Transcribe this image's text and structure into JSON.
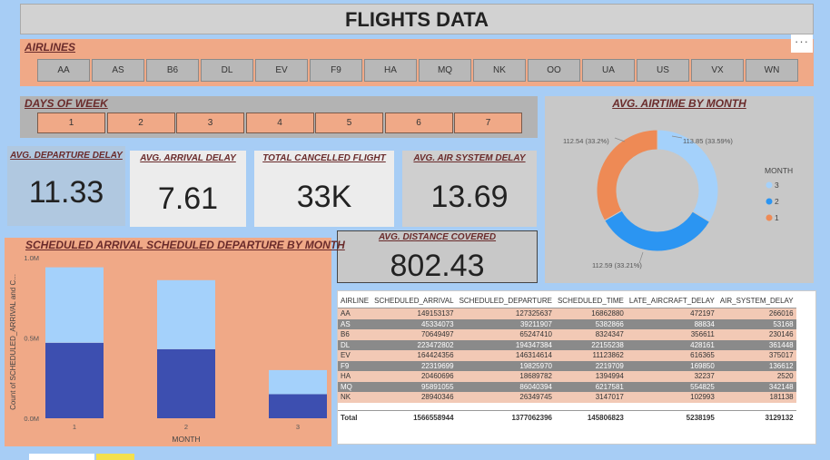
{
  "title": "FLIGHTS DATA",
  "more_options": "···",
  "airlines": {
    "title": "AIRLINES",
    "items": [
      "AA",
      "AS",
      "B6",
      "DL",
      "EV",
      "F9",
      "HA",
      "MQ",
      "NK",
      "OO",
      "UA",
      "US",
      "VX",
      "WN"
    ]
  },
  "days_of_week": {
    "title": "DAYS OF WEEK",
    "items": [
      "1",
      "2",
      "3",
      "4",
      "5",
      "6",
      "7"
    ]
  },
  "kpis": {
    "departure": {
      "title": "AVG. DEPARTURE DELAY",
      "value": "11.33"
    },
    "arrival": {
      "title": "AVG. ARRIVAL DELAY",
      "value": "7.61"
    },
    "cancelled": {
      "title": "TOTAL CANCELLED FLIGHT",
      "value": "33K"
    },
    "air_system": {
      "title": "AVG. AIR SYSTEM DELAY",
      "value": "13.69"
    },
    "distance": {
      "title": "AVG. DISTANCE COVERED",
      "value": "802.43"
    }
  },
  "colors": {
    "salmon": "#f0a987",
    "month1": "#ee8a55",
    "month2": "#2b95f2",
    "month3": "#a4d1fb",
    "bar_dark": "#3d4fb0",
    "bar_light": "#a4d1fb"
  },
  "chart_data": [
    {
      "type": "pie",
      "title": "AVG. AIRTIME BY MONTH",
      "legend_title": "MONTH",
      "legend_position": "right",
      "slices": [
        {
          "label": "3",
          "value": 113.85,
          "pct": "33.59%",
          "data_label": "113.85 (33.59%)"
        },
        {
          "label": "2",
          "value": 112.59,
          "pct": "33.21%",
          "data_label": "112.59 (33.21%)"
        },
        {
          "label": "1",
          "value": 112.54,
          "pct": "33.2%",
          "data_label": "112.54 (33.2%)"
        }
      ]
    },
    {
      "type": "bar",
      "title": "SCHEDULED ARRIVAL SCHEDULED DEPARTURE BY MONTH",
      "xlabel": "MONTH",
      "ylabel": "Count of SCHEDULED_ARRIVAL and C...",
      "categories": [
        "1",
        "2",
        "3"
      ],
      "ylim": [
        0,
        1000000
      ],
      "yticks": [
        "0.0M",
        "0.5M",
        "1.0M"
      ],
      "stacked": true,
      "series": [
        {
          "values": [
            470000,
            430000,
            150000
          ]
        },
        {
          "values": [
            470000,
            430000,
            150000
          ]
        }
      ]
    }
  ],
  "table": {
    "headers": [
      "AIRLINE",
      "SCHEDULED_ARRIVAL",
      "SCHEDULED_DEPARTURE",
      "SCHEDULED_TIME",
      "LATE_AIRCRAFT_DELAY",
      "AIR_SYSTEM_DELAY"
    ],
    "rows": [
      [
        "AA",
        "149153137",
        "127325637",
        "16862880",
        "472197",
        "266016"
      ],
      [
        "AS",
        "45334073",
        "39211907",
        "5382866",
        "88834",
        "53168"
      ],
      [
        "B6",
        "70649497",
        "65247410",
        "8324347",
        "356611",
        "230146"
      ],
      [
        "DL",
        "223472802",
        "194347384",
        "22155238",
        "428161",
        "361448"
      ],
      [
        "EV",
        "164424356",
        "146314614",
        "11123862",
        "616365",
        "375017"
      ],
      [
        "F9",
        "22319699",
        "19825970",
        "2219709",
        "169850",
        "136612"
      ],
      [
        "HA",
        "20460696",
        "18689782",
        "1394994",
        "32237",
        "2520"
      ],
      [
        "MQ",
        "95891055",
        "86040394",
        "6217581",
        "554825",
        "342148"
      ],
      [
        "NK",
        "28940346",
        "26349745",
        "3147017",
        "102993",
        "181138"
      ]
    ],
    "total": [
      "Total",
      "1566558944",
      "1377062396",
      "145806823",
      "5238195",
      "3129132"
    ]
  }
}
